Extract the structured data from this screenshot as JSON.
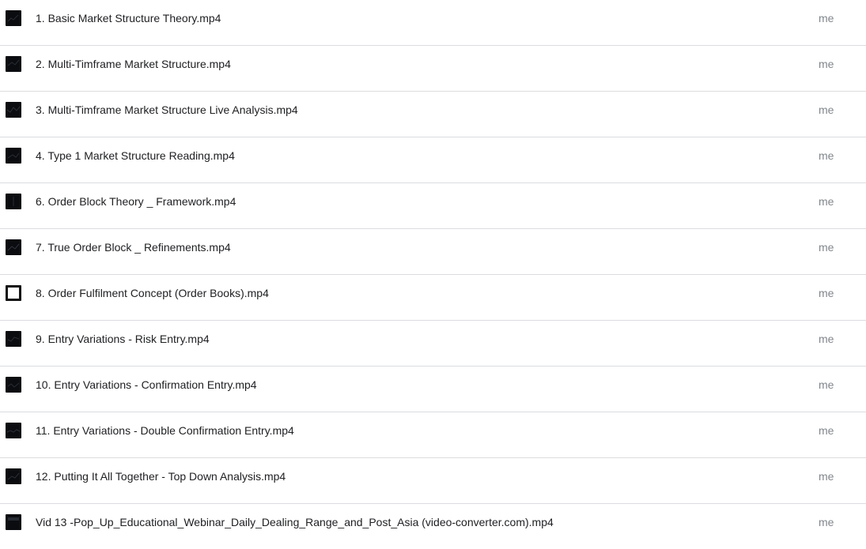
{
  "files": [
    {
      "name": "1. Basic Market Structure Theory.mp4",
      "owner": "me",
      "thumbnail": "dark-video-thumbnail"
    },
    {
      "name": "2. Multi-Timframe Market Structure.mp4",
      "owner": "me",
      "thumbnail": "dark-video-thumbnail"
    },
    {
      "name": "3. Multi-Timframe Market Structure Live Analysis.mp4",
      "owner": "me",
      "thumbnail": "dark-video-thumbnail"
    },
    {
      "name": "4. Type 1 Market Structure Reading.mp4",
      "owner": "me",
      "thumbnail": "dark-video-thumbnail"
    },
    {
      "name": "6. Order Block Theory _ Framework.mp4",
      "owner": "me",
      "thumbnail": "dark-video-thumbnail"
    },
    {
      "name": "7. True Order Block _ Refinements.mp4",
      "owner": "me",
      "thumbnail": "dark-video-thumbnail"
    },
    {
      "name": "8. Order Fulfilment Concept (Order Books).mp4",
      "owner": "me",
      "thumbnail": "framed-video-thumbnail"
    },
    {
      "name": "9. Entry Variations - Risk Entry.mp4",
      "owner": "me",
      "thumbnail": "dark-video-thumbnail"
    },
    {
      "name": "10. Entry Variations - Confirmation Entry.mp4",
      "owner": "me",
      "thumbnail": "dark-video-thumbnail"
    },
    {
      "name": "11. Entry Variations - Double Confirmation Entry.mp4",
      "owner": "me",
      "thumbnail": "dark-video-thumbnail"
    },
    {
      "name": "12. Putting It All Together - Top Down Analysis.mp4",
      "owner": "me",
      "thumbnail": "dark-video-thumbnail"
    },
    {
      "name": "Vid 13 -Pop_Up_Educational_Webinar_Daily_Dealing_Range_and_Post_Asia (video-converter.com).mp4",
      "owner": "me",
      "thumbnail": "dark-video-thumbnail"
    }
  ],
  "colors": {
    "divider": "#dadce0",
    "text": "#202124",
    "owner_text": "#80868b",
    "thumbnail_dark": "#0b0c10"
  }
}
